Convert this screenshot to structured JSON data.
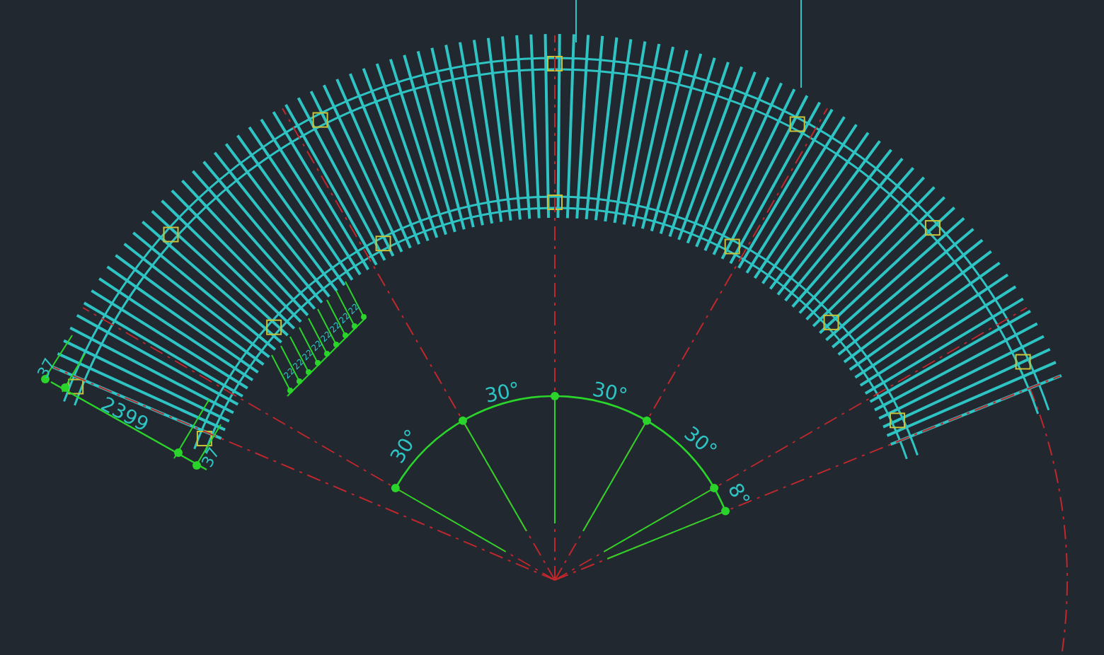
{
  "drawing": {
    "length_dimensions": [
      {
        "text": "37"
      },
      {
        "text": "2399"
      },
      {
        "text": "37"
      }
    ],
    "spacing_dimensions": [
      {
        "text": "22"
      },
      {
        "text": "22"
      },
      {
        "text": "22"
      },
      {
        "text": "22"
      },
      {
        "text": "22"
      },
      {
        "text": "22"
      },
      {
        "text": "22"
      },
      {
        "text": "22"
      }
    ],
    "angle_dimensions": [
      {
        "text": "30°"
      },
      {
        "text": "30°"
      },
      {
        "text": "30°"
      },
      {
        "text": "30°"
      },
      {
        "text": "8°"
      }
    ]
  }
}
